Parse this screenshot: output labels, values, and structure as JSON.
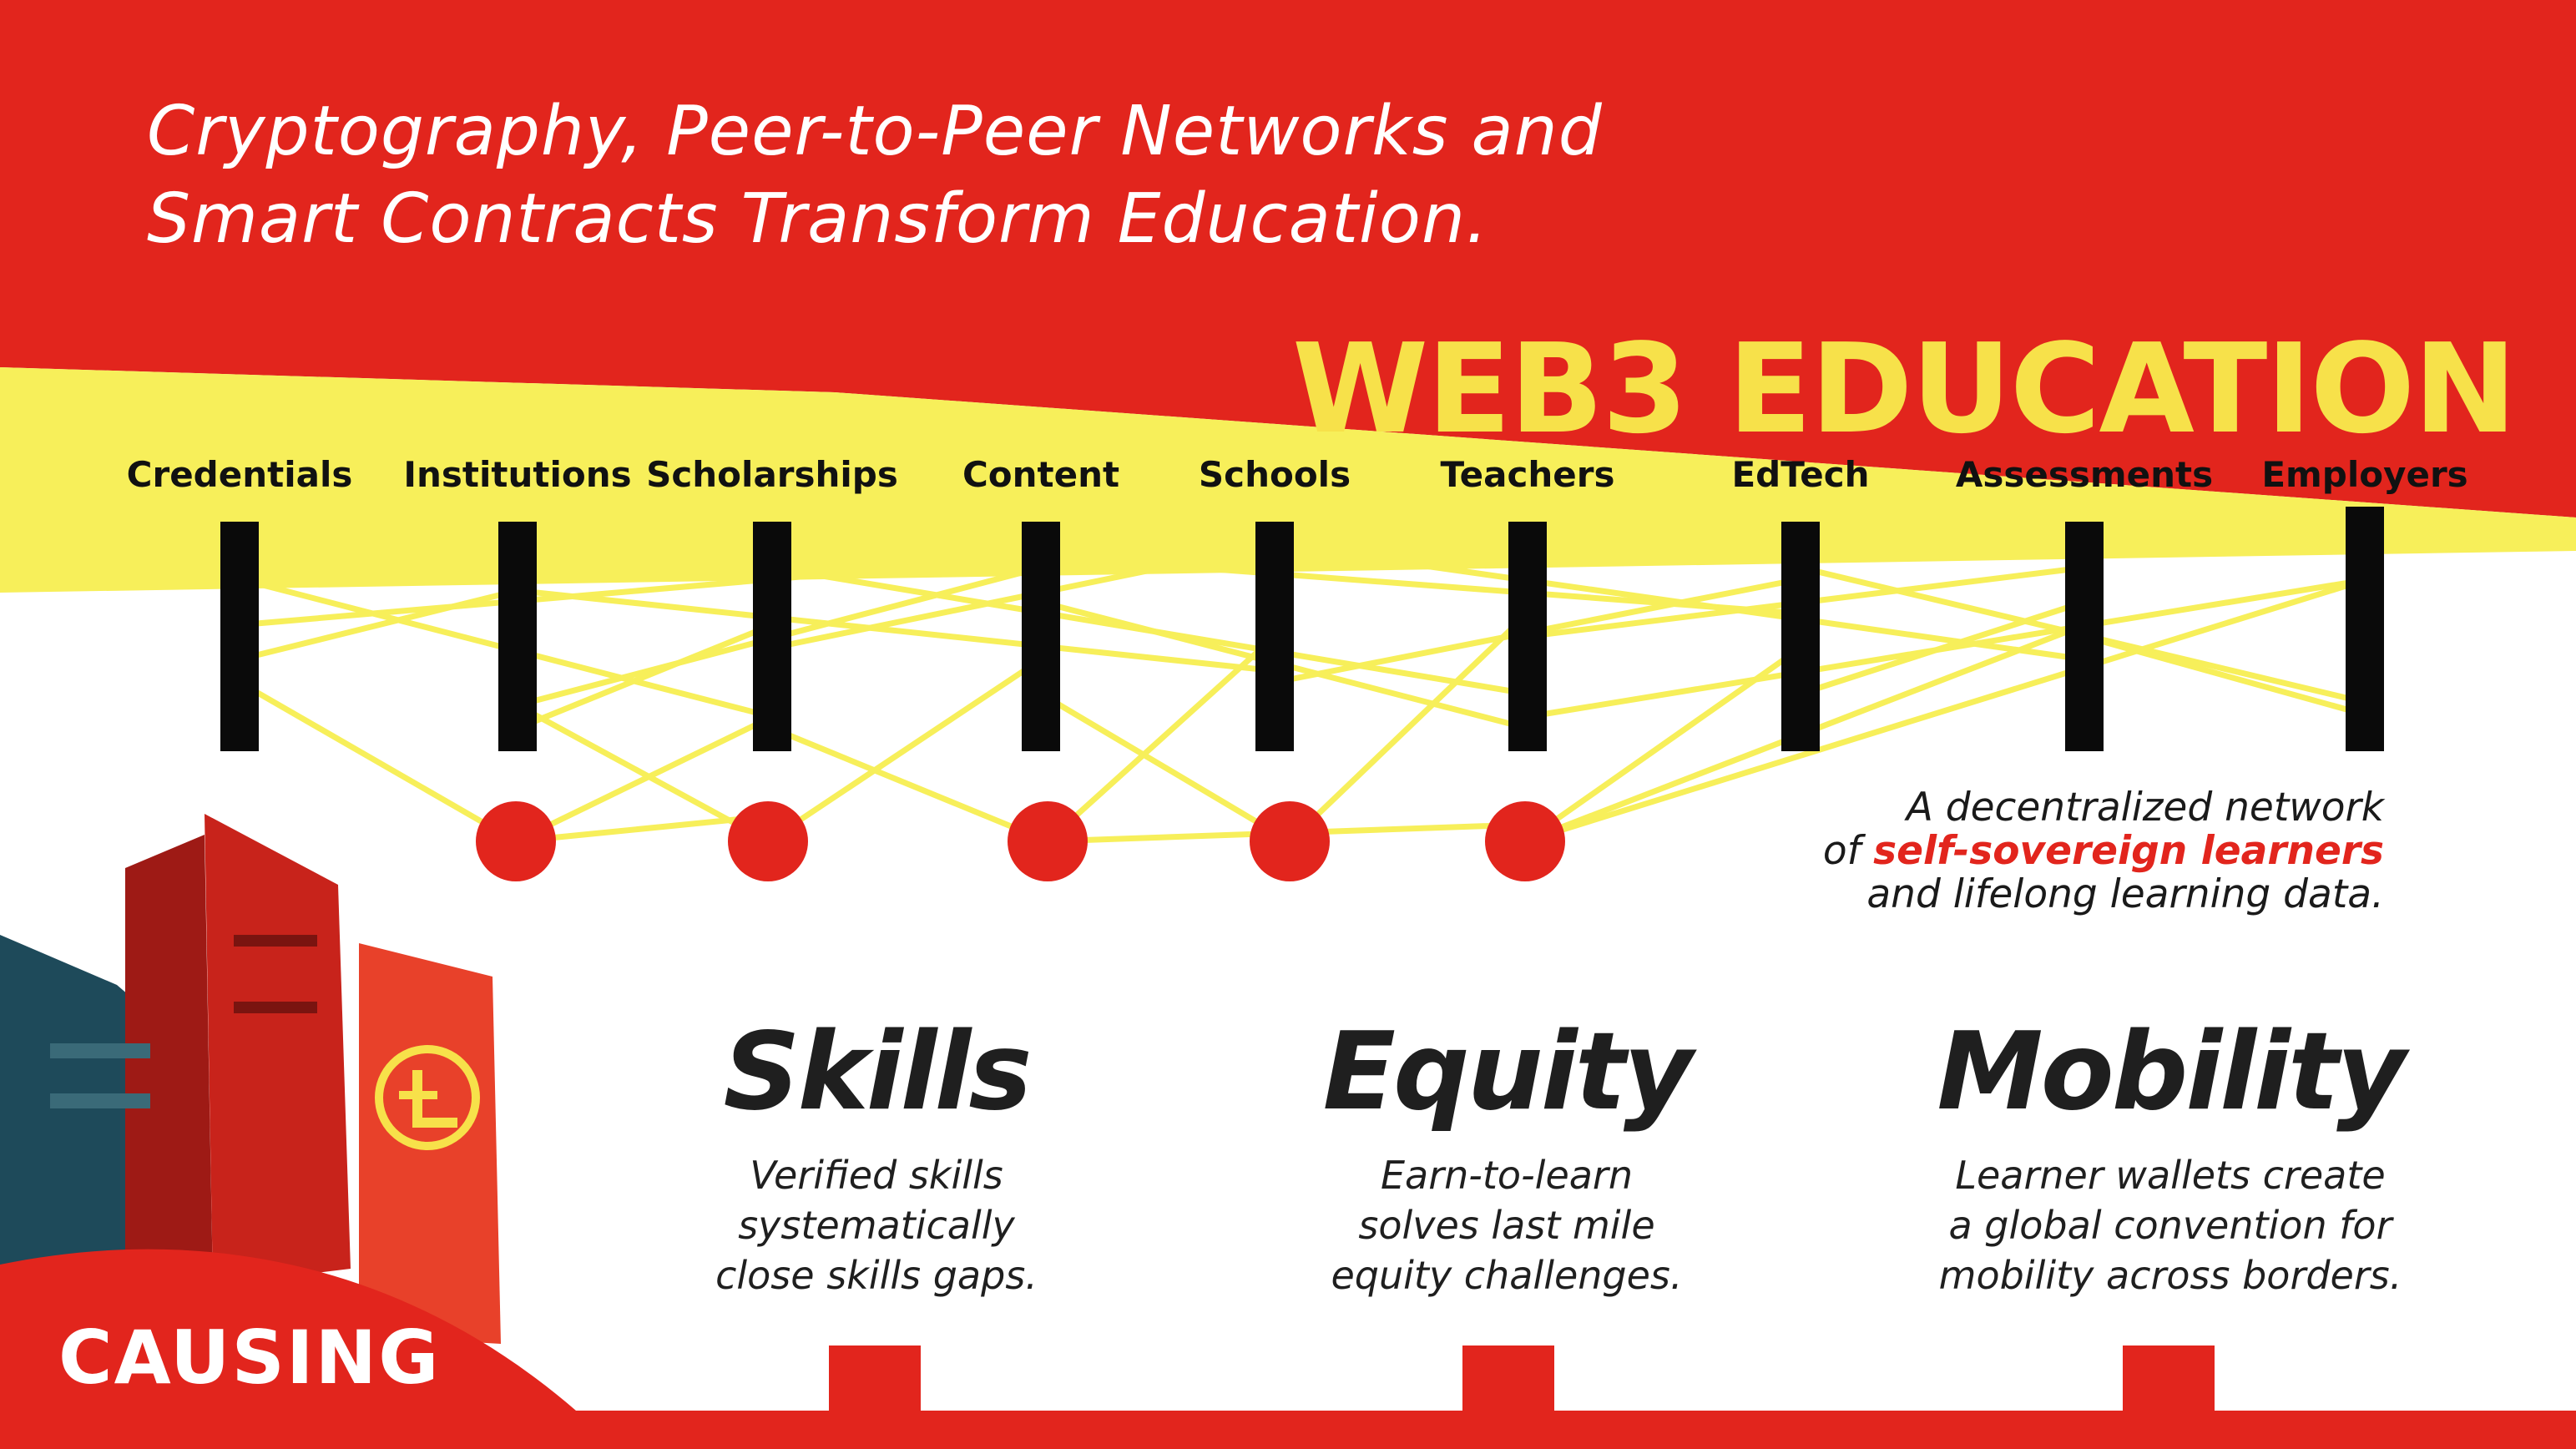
{
  "title_lines": [
    "Cryptography, Peer-to-Peer Networks and",
    "Smart Contracts Transform Education."
  ],
  "banner_title": "WEB3 EDUCATION",
  "nodes": [
    {
      "label": "Credentials"
    },
    {
      "label": "Institutions"
    },
    {
      "label": "Scholarships"
    },
    {
      "label": "Content"
    },
    {
      "label": "Schools"
    },
    {
      "label": "Teachers"
    },
    {
      "label": "EdTech"
    },
    {
      "label": "Assessments"
    },
    {
      "label": "Employers"
    }
  ],
  "network_dots": 5,
  "tagline": {
    "line1": "A decentralized network",
    "line2_prefix": "of ",
    "line2_highlight": "self-sovereign learners",
    "line3": "and lifelong learning data."
  },
  "pillars": [
    {
      "title": "Skills",
      "lines": [
        "Verified skills",
        "systematically",
        "close skills gaps."
      ]
    },
    {
      "title": "Equity",
      "lines": [
        "Earn-to-learn",
        "solves last mile",
        "equity challenges."
      ]
    },
    {
      "title": "Mobility",
      "lines": [
        "Learner wallets create",
        "a global convention for",
        "mobility across borders."
      ]
    }
  ],
  "causing_label": "CAUSING",
  "colors": {
    "red": "#e2251d",
    "yellow": "#f7ef5a",
    "node_bar": "#0a0a0a",
    "dark_text": "#1f1f1f",
    "white": "#ffffff"
  }
}
